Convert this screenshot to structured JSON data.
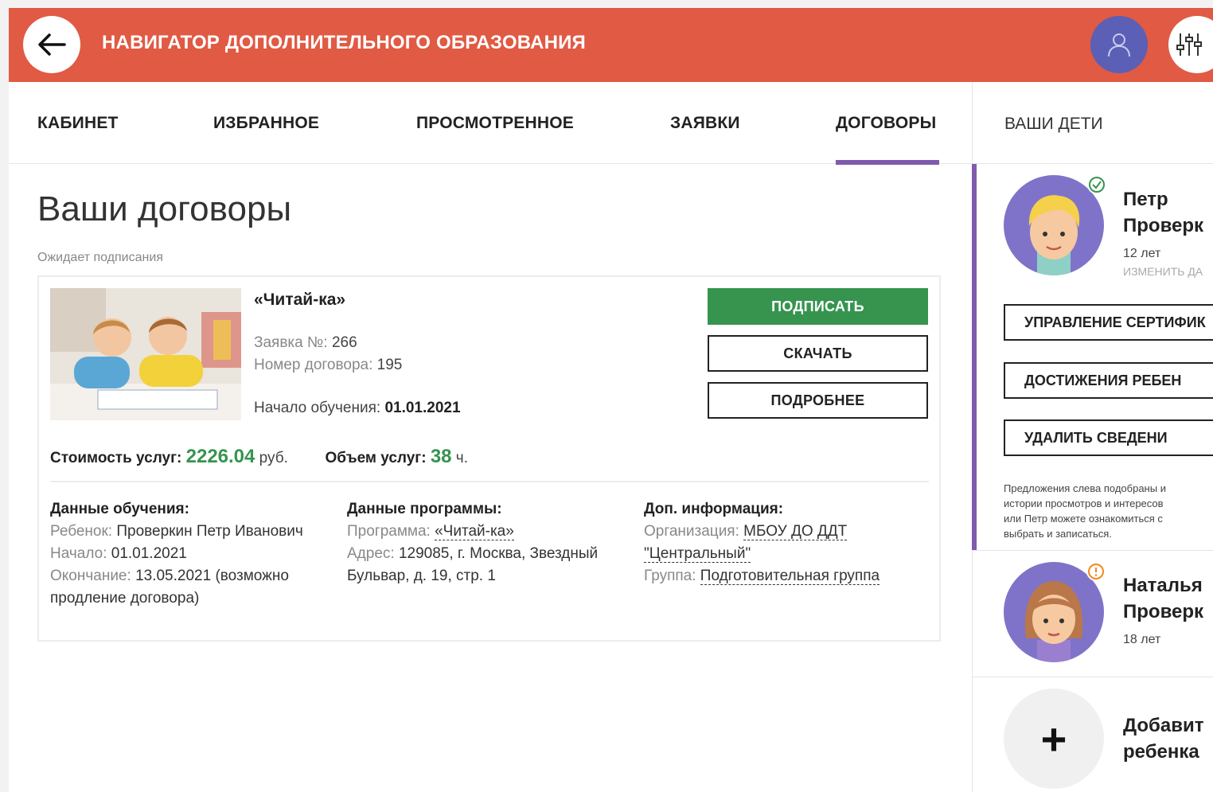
{
  "header": {
    "title": "НАВИГАТОР ДОПОЛНИТЕЛЬНОГО ОБРАЗОВАНИЯ",
    "back_icon": "arrow-left-icon",
    "user_icon": "user-icon",
    "filter_icon": "sliders-icon"
  },
  "tabs": [
    {
      "label": "КАБИНЕТ"
    },
    {
      "label": "ИЗБРАННОЕ"
    },
    {
      "label": "ПРОСМОТРЕННОЕ"
    },
    {
      "label": "ЗАЯВКИ"
    },
    {
      "label": "ДОГОВОРЫ",
      "active": true
    }
  ],
  "sidebar_title": "ВАШИ ДЕТИ",
  "main": {
    "title": "Ваши договоры",
    "subtitle": "Ожидает подписания"
  },
  "contract": {
    "program_name": "«Читай-ка»",
    "request_label": "Заявка №:",
    "request_value": "266",
    "contract_label": "Номер договора:",
    "contract_value": "195",
    "start_label": "Начало обучения:",
    "start_value": "01.01.2021",
    "buttons": {
      "sign": "ПОДПИСАТЬ",
      "download": "СКАЧАТЬ",
      "details": "ПОДРОБНЕЕ"
    },
    "cost_label": "Стоимость услуг:",
    "cost_value": "2226.04",
    "cost_unit": "руб.",
    "volume_label": "Объем услуг:",
    "volume_value": "38",
    "volume_unit": "ч.",
    "study": {
      "title": "Данные обучения:",
      "child_label": "Ребенок:",
      "child_value": "Проверкин Петр Иванович",
      "begin_label": "Начало:",
      "begin_value": "01.01.2021",
      "end_label": "Окончание:",
      "end_value": "13.05.2021 (возможно продление договора)"
    },
    "program": {
      "title": "Данные программы:",
      "program_label": "Программа:",
      "program_value": "«Читай-ка»",
      "address_label": "Адрес:",
      "address_value": "129085, г. Москва, Звездный Бульвар, д. 19, стр. 1"
    },
    "extra": {
      "title": "Доп. информация:",
      "org_label": "Организация:",
      "org_value": "МБОУ ДО ДДТ \"Центральный\"",
      "group_label": "Группа:",
      "group_value": "Подготовительная группа"
    }
  },
  "children": [
    {
      "name_first": "Петр",
      "name_last": "Проверк",
      "age": "12 лет",
      "edit": "ИЗМЕНИТЬ ДА",
      "status_icon": "check-circle-icon",
      "status_color": "#36944f"
    },
    {
      "name_first": "Наталья",
      "name_last": "Проверк",
      "age": "18 лет",
      "status_icon": "exclamation-circle-icon",
      "status_color": "#f08a1c"
    }
  ],
  "side_buttons": {
    "certificate": "УПРАВЛЕНИЕ СЕРТИФИК",
    "achievements": "ДОСТИЖЕНИЯ РЕБЕН",
    "delete": "УДАЛИТЬ СВЕДЕНИ"
  },
  "side_note": {
    "line1": "Предложения слева подобраны и",
    "line2": "истории просмотров и интересов",
    "line3": "или Петр можете ознакомиться с",
    "line4": "выбрать и записаться."
  },
  "add_child": {
    "line1": "Добавит",
    "line2": "ребенка",
    "icon": "plus-icon"
  },
  "colors": {
    "header": "#e05a44",
    "accent": "#7f5aad",
    "green": "#36944f",
    "user_btn": "#5b5fb5"
  }
}
